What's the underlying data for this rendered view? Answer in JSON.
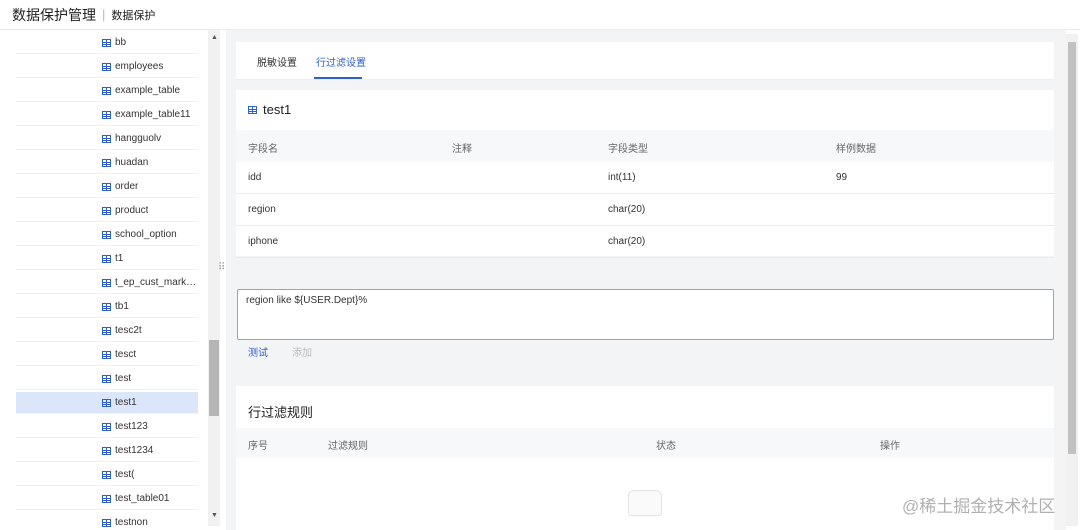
{
  "header": {
    "title": "数据保护管理",
    "separator": "|",
    "subtitle": "数据保护"
  },
  "tree": {
    "items": [
      {
        "label": "bb"
      },
      {
        "label": "employees"
      },
      {
        "label": "example_table"
      },
      {
        "label": "example_table11"
      },
      {
        "label": "hangguolv"
      },
      {
        "label": "huadan"
      },
      {
        "label": "order"
      },
      {
        "label": "product"
      },
      {
        "label": "school_option"
      },
      {
        "label": "t1"
      },
      {
        "label": "t_ep_cust_marke..."
      },
      {
        "label": "tb1"
      },
      {
        "label": "tesc2t"
      },
      {
        "label": "tesct"
      },
      {
        "label": "test"
      },
      {
        "label": "test1",
        "selected": true
      },
      {
        "label": "test123"
      },
      {
        "label": "test1234"
      },
      {
        "label": "test("
      },
      {
        "label": "test_table01"
      },
      {
        "label": "testnon"
      }
    ]
  },
  "tabs": [
    {
      "label": "脱敏设置",
      "active": false
    },
    {
      "label": "行过滤设置",
      "active": true
    }
  ],
  "table": {
    "name": "test1",
    "columns": [
      "字段名",
      "注释",
      "字段类型",
      "样例数据"
    ],
    "rows": [
      [
        "idd",
        "",
        "int(11)",
        "99"
      ],
      [
        "region",
        "",
        "char(20)",
        ""
      ],
      [
        "iphone",
        "",
        "char(20)",
        ""
      ]
    ]
  },
  "filter": {
    "expression": "region like ${USER.Dept}%",
    "test_label": "测试",
    "add_label": "添加"
  },
  "rules": {
    "title": "行过滤规则",
    "columns": [
      "序号",
      "过滤规则",
      "状态",
      "操作"
    ]
  },
  "watermark": "@稀土掘金技术社区",
  "colors": {
    "accent": "#2f5ecf",
    "selected_bg": "#dbe6fb",
    "main_bg": "#f3f4f6"
  },
  "icons": [
    "table-icon",
    "scroll-up-arrow",
    "scroll-down-arrow",
    "drag-handle-icon",
    "empty-box-icon"
  ]
}
